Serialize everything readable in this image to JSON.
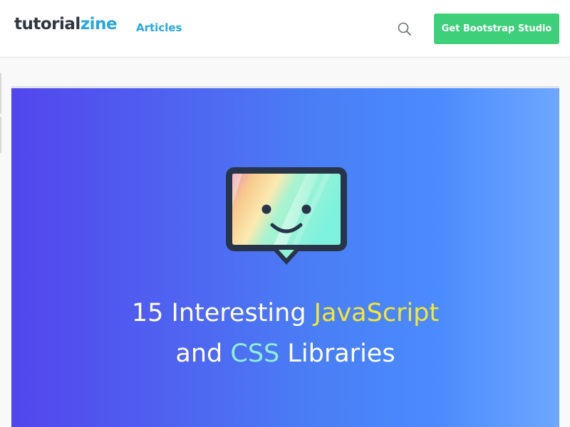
{
  "header": {
    "logo_part1": "tutorial",
    "logo_part2": "zine",
    "nav_articles": "Articles",
    "search_icon": "search-icon",
    "cta_label": "Get Bootstrap Studio"
  },
  "hero": {
    "icon": "smiling-chat-bubble-icon",
    "line1_prefix": "15 Interesting ",
    "line1_highlight": "JavaScript",
    "line2_prefix": "and ",
    "line2_highlight": "CSS",
    "line2_suffix": " Libraries"
  },
  "colors": {
    "brand_dark": "#2f3640",
    "brand_blue": "#2aa6dd",
    "cta_green": "#3ecf7a",
    "highlight_yellow": "#f7e82a",
    "highlight_teal": "#8ff0d3",
    "hero_gradient_start": "#5246ed",
    "hero_gradient_end": "#6ea7ff"
  }
}
